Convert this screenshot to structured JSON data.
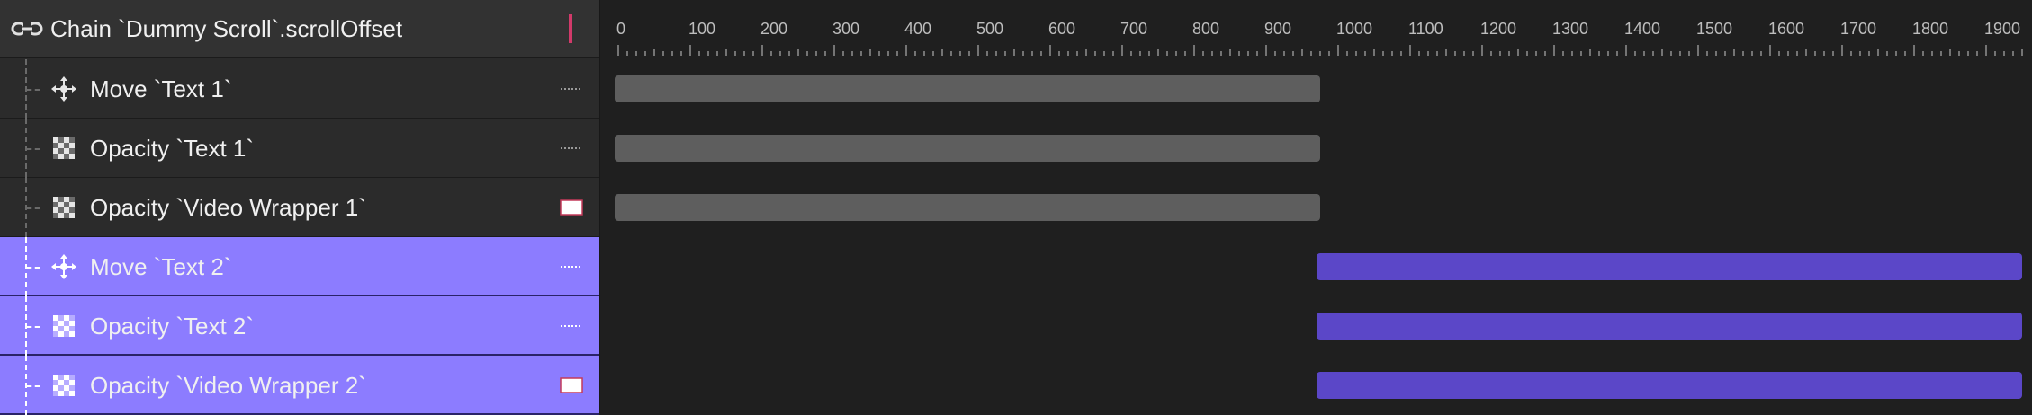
{
  "header": {
    "title": "Chain `Dummy Scroll`.scrollOffset",
    "icon": "chain-link-icon",
    "indicator_color": "#d23a6a"
  },
  "tracks": [
    {
      "label": "Move `Text 1`",
      "icon": "move-arrows-icon",
      "selected": false,
      "start": 0,
      "end": 975,
      "right_glyph": "dotted-line-icon"
    },
    {
      "label": "Opacity `Text 1`",
      "icon": "checkerboard-icon",
      "selected": false,
      "start": 0,
      "end": 975,
      "right_glyph": "dotted-line-icon"
    },
    {
      "label": "Opacity `Video Wrapper 1`",
      "icon": "checkerboard-icon",
      "selected": false,
      "start": 0,
      "end": 975,
      "right_glyph": "dotted-box-icon"
    },
    {
      "label": "Move `Text 2`",
      "icon": "move-arrows-icon",
      "selected": true,
      "start": 975,
      "end": 1950,
      "right_glyph": "dotted-line-icon"
    },
    {
      "label": "Opacity `Text 2`",
      "icon": "checkerboard-icon",
      "selected": true,
      "start": 975,
      "end": 1950,
      "right_glyph": "dotted-line-icon"
    },
    {
      "label": "Opacity `Video Wrapper 2`",
      "icon": "checkerboard-icon",
      "selected": true,
      "start": 975,
      "end": 1950,
      "right_glyph": "dotted-box-icon"
    }
  ],
  "ruler": {
    "labels": [
      "0",
      "100",
      "200",
      "300",
      "400",
      "500",
      "600",
      "700",
      "800",
      "900",
      "1000",
      "1100",
      "1200",
      "1300",
      "1400",
      "1500",
      "1600",
      "1700",
      "1800",
      "1900"
    ],
    "min": 0,
    "max": 1950
  },
  "colors": {
    "bar_inactive": "#5e5e5e",
    "bar_active": "#5b47c8",
    "row_selected": "#8c7cff"
  }
}
